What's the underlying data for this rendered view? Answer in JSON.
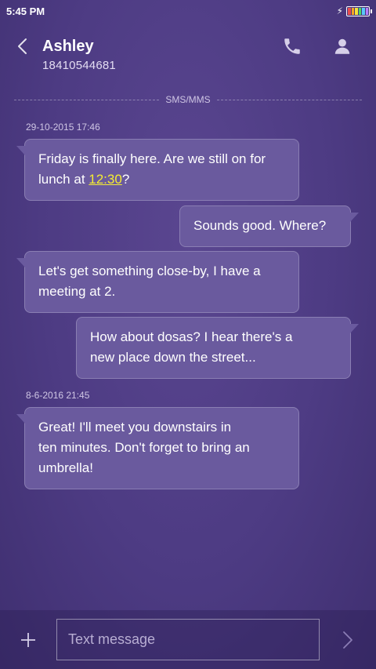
{
  "status_bar": {
    "time": "5:45 PM",
    "battery_colors": [
      "#e84c4c",
      "#f5a623",
      "#f5e23a",
      "#4cd964",
      "#5ac8fa",
      "#b47cff"
    ]
  },
  "header": {
    "contact_name": "Ashley",
    "contact_number": "18410544681",
    "icons": [
      "back-icon",
      "call-icon",
      "contact-icon"
    ]
  },
  "channel_label": "SMS/MMS",
  "timestamps": [
    "29-10-2015 17:46",
    "8-6-2016 21:45"
  ],
  "messages": [
    {
      "direction": "in",
      "line1": "Friday is finally here. Are we still on for",
      "line2_prefix": "lunch at ",
      "line2_link": "12:30",
      "line2_suffix": "?"
    },
    {
      "direction": "out",
      "line1": "Sounds good. Where?"
    },
    {
      "direction": "in",
      "line1": "Let's get something close-by, I have a",
      "line2": "meeting at 2."
    },
    {
      "direction": "out",
      "line1": "How about dosas? I hear there's a",
      "line2": "new place down the street..."
    },
    {
      "direction": "in",
      "line1": "Great! I'll meet you downstairs in",
      "line2": "ten minutes. Don't forget to bring an",
      "line3": "umbrella!"
    }
  ],
  "composer": {
    "placeholder": "Text message",
    "value": "",
    "icons": [
      "add-icon",
      "send-icon"
    ]
  },
  "colors": {
    "background": "#4d3b83",
    "bubble": "#6a5a9e",
    "link": "#f5ed32"
  }
}
